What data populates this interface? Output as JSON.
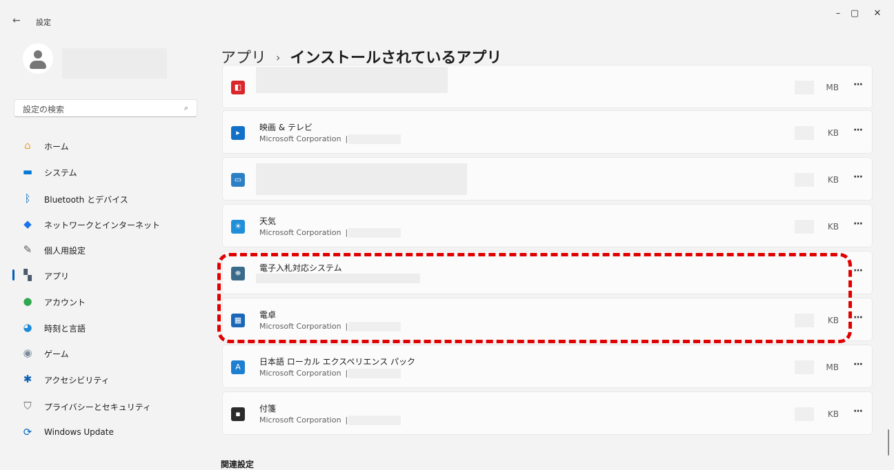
{
  "titlebar": {
    "back": "←",
    "title": "設定",
    "minimize": "–",
    "restore": "▢",
    "close": "✕"
  },
  "search": {
    "placeholder": "設定の検索",
    "icon": "⌕"
  },
  "sidebar": {
    "items": [
      {
        "label": "ホーム",
        "icon": "home-icon",
        "glyph": "⌂",
        "color": "#e8a33a"
      },
      {
        "label": "システム",
        "icon": "system-icon",
        "glyph": "▬",
        "color": "#0078d4"
      },
      {
        "label": "Bluetooth とデバイス",
        "icon": "bluetooth-icon",
        "glyph": "ᛒ",
        "color": "#0067c0"
      },
      {
        "label": "ネットワークとインターネット",
        "icon": "network-icon",
        "glyph": "◆",
        "color": "#1a73e8"
      },
      {
        "label": "個人用設定",
        "icon": "brush-icon",
        "glyph": "✎",
        "color": "#5a5a5a"
      },
      {
        "label": "アプリ",
        "icon": "apps-icon",
        "glyph": "▚",
        "color": "#4a5a6a"
      },
      {
        "label": "アカウント",
        "icon": "account-icon",
        "glyph": "●",
        "color": "#2fa84f"
      },
      {
        "label": "時刻と言語",
        "icon": "time-language-icon",
        "glyph": "◕",
        "color": "#1c8ad9"
      },
      {
        "label": "ゲーム",
        "icon": "game-icon",
        "glyph": "◉",
        "color": "#7a8a9a"
      },
      {
        "label": "アクセシビリティ",
        "icon": "accessibility-icon",
        "glyph": "✱",
        "color": "#0a5fb4"
      },
      {
        "label": "プライバシーとセキュリティ",
        "icon": "shield-icon",
        "glyph": "⛉",
        "color": "#6a6a6a"
      },
      {
        "label": "Windows Update",
        "icon": "windows-update-icon",
        "glyph": "⟳",
        "color": "#0067c0"
      }
    ]
  },
  "breadcrumb": {
    "parent": "アプリ",
    "separator": "›",
    "current": "インストールされているアプリ"
  },
  "apps": [
    {
      "name": "",
      "publisher": "",
      "size_unit": "MB",
      "icon": "red-tool-icon",
      "glyph": "◧",
      "color": "#d9262b"
    },
    {
      "name": "映画 & テレビ",
      "publisher": "Microsoft Corporation",
      "size_unit": "KB",
      "icon": "movies-tv-icon",
      "glyph": "▸",
      "color": "#1170c7"
    },
    {
      "name": "",
      "publisher": "",
      "size_unit": "KB",
      "icon": "monitor-icon",
      "glyph": "▭",
      "color": "#2b7fc4"
    },
    {
      "name": "天気",
      "publisher": "Microsoft Corporation",
      "size_unit": "KB",
      "icon": "weather-icon",
      "glyph": "☀",
      "color": "#1e8fd8"
    },
    {
      "name": "電子入札対応システム",
      "publisher": "",
      "size_unit": "",
      "icon": "bidding-system-icon",
      "glyph": "⛯",
      "color": "#3b6a8a"
    },
    {
      "name": "電卓",
      "publisher": "Microsoft Corporation",
      "size_unit": "KB",
      "icon": "calculator-icon",
      "glyph": "▦",
      "color": "#1a66b8"
    },
    {
      "name": "日本語 ローカル エクスペリエンス パック",
      "publisher": "Microsoft Corporation",
      "size_unit": "MB",
      "icon": "language-pack-icon",
      "glyph": "A",
      "color": "#1e7fd0"
    },
    {
      "name": "付箋",
      "publisher": "Microsoft Corporation",
      "size_unit": "KB",
      "icon": "sticky-notes-icon",
      "glyph": "▪",
      "color": "#2b2b2b"
    }
  ],
  "more_glyph": "···",
  "publisher_separator": "|",
  "related": {
    "title": "関連設定"
  },
  "colors": {
    "accent": "#005fb8",
    "highlight": "#e00000"
  }
}
